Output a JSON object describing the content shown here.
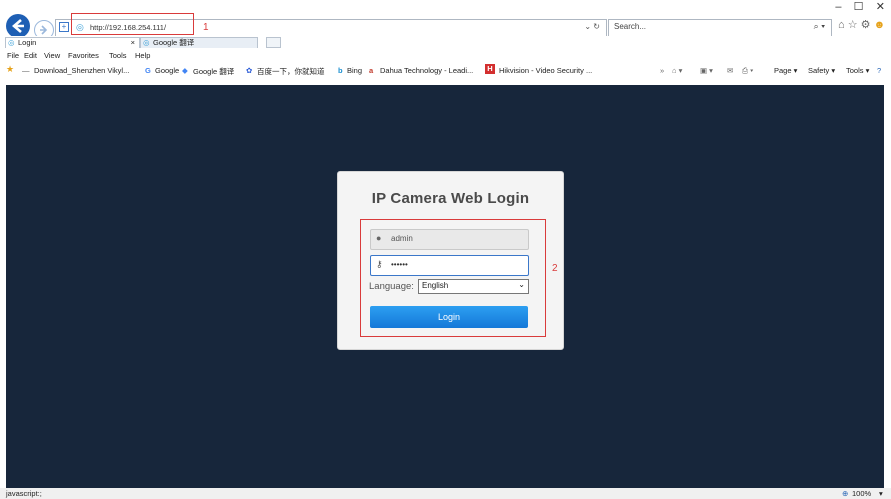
{
  "browser": {
    "url": "http://192.168.254.111/",
    "search_placeholder": "Search...",
    "tabs": [
      {
        "label": "Login",
        "close": "×"
      },
      {
        "label": "Google 翻译"
      }
    ],
    "menu": [
      "File",
      "Edit",
      "View",
      "Favorites",
      "Tools",
      "Help"
    ],
    "favorites": [
      "Download_Shenzhen Vikyl...",
      "Google",
      "Google 翻译",
      "百度一下，你就知道",
      "Bing",
      "Dahua Technology - Leadi...",
      "Hikvision - Video Security ..."
    ],
    "command_bar": [
      "Page ▾",
      "Safety ▾",
      "Tools ▾"
    ],
    "status_text": "javascript:;",
    "zoom": "100%"
  },
  "annotations": {
    "label1": "1",
    "label2": "2"
  },
  "login": {
    "title": "IP Camera Web Login",
    "username": "admin",
    "password_mask": "••••••",
    "language_label": "Language:",
    "language_selected": "English",
    "button_label": "Login"
  },
  "colors": {
    "background": "#17263b",
    "button": "#1e8be6",
    "annotation": "#d93b3b"
  }
}
